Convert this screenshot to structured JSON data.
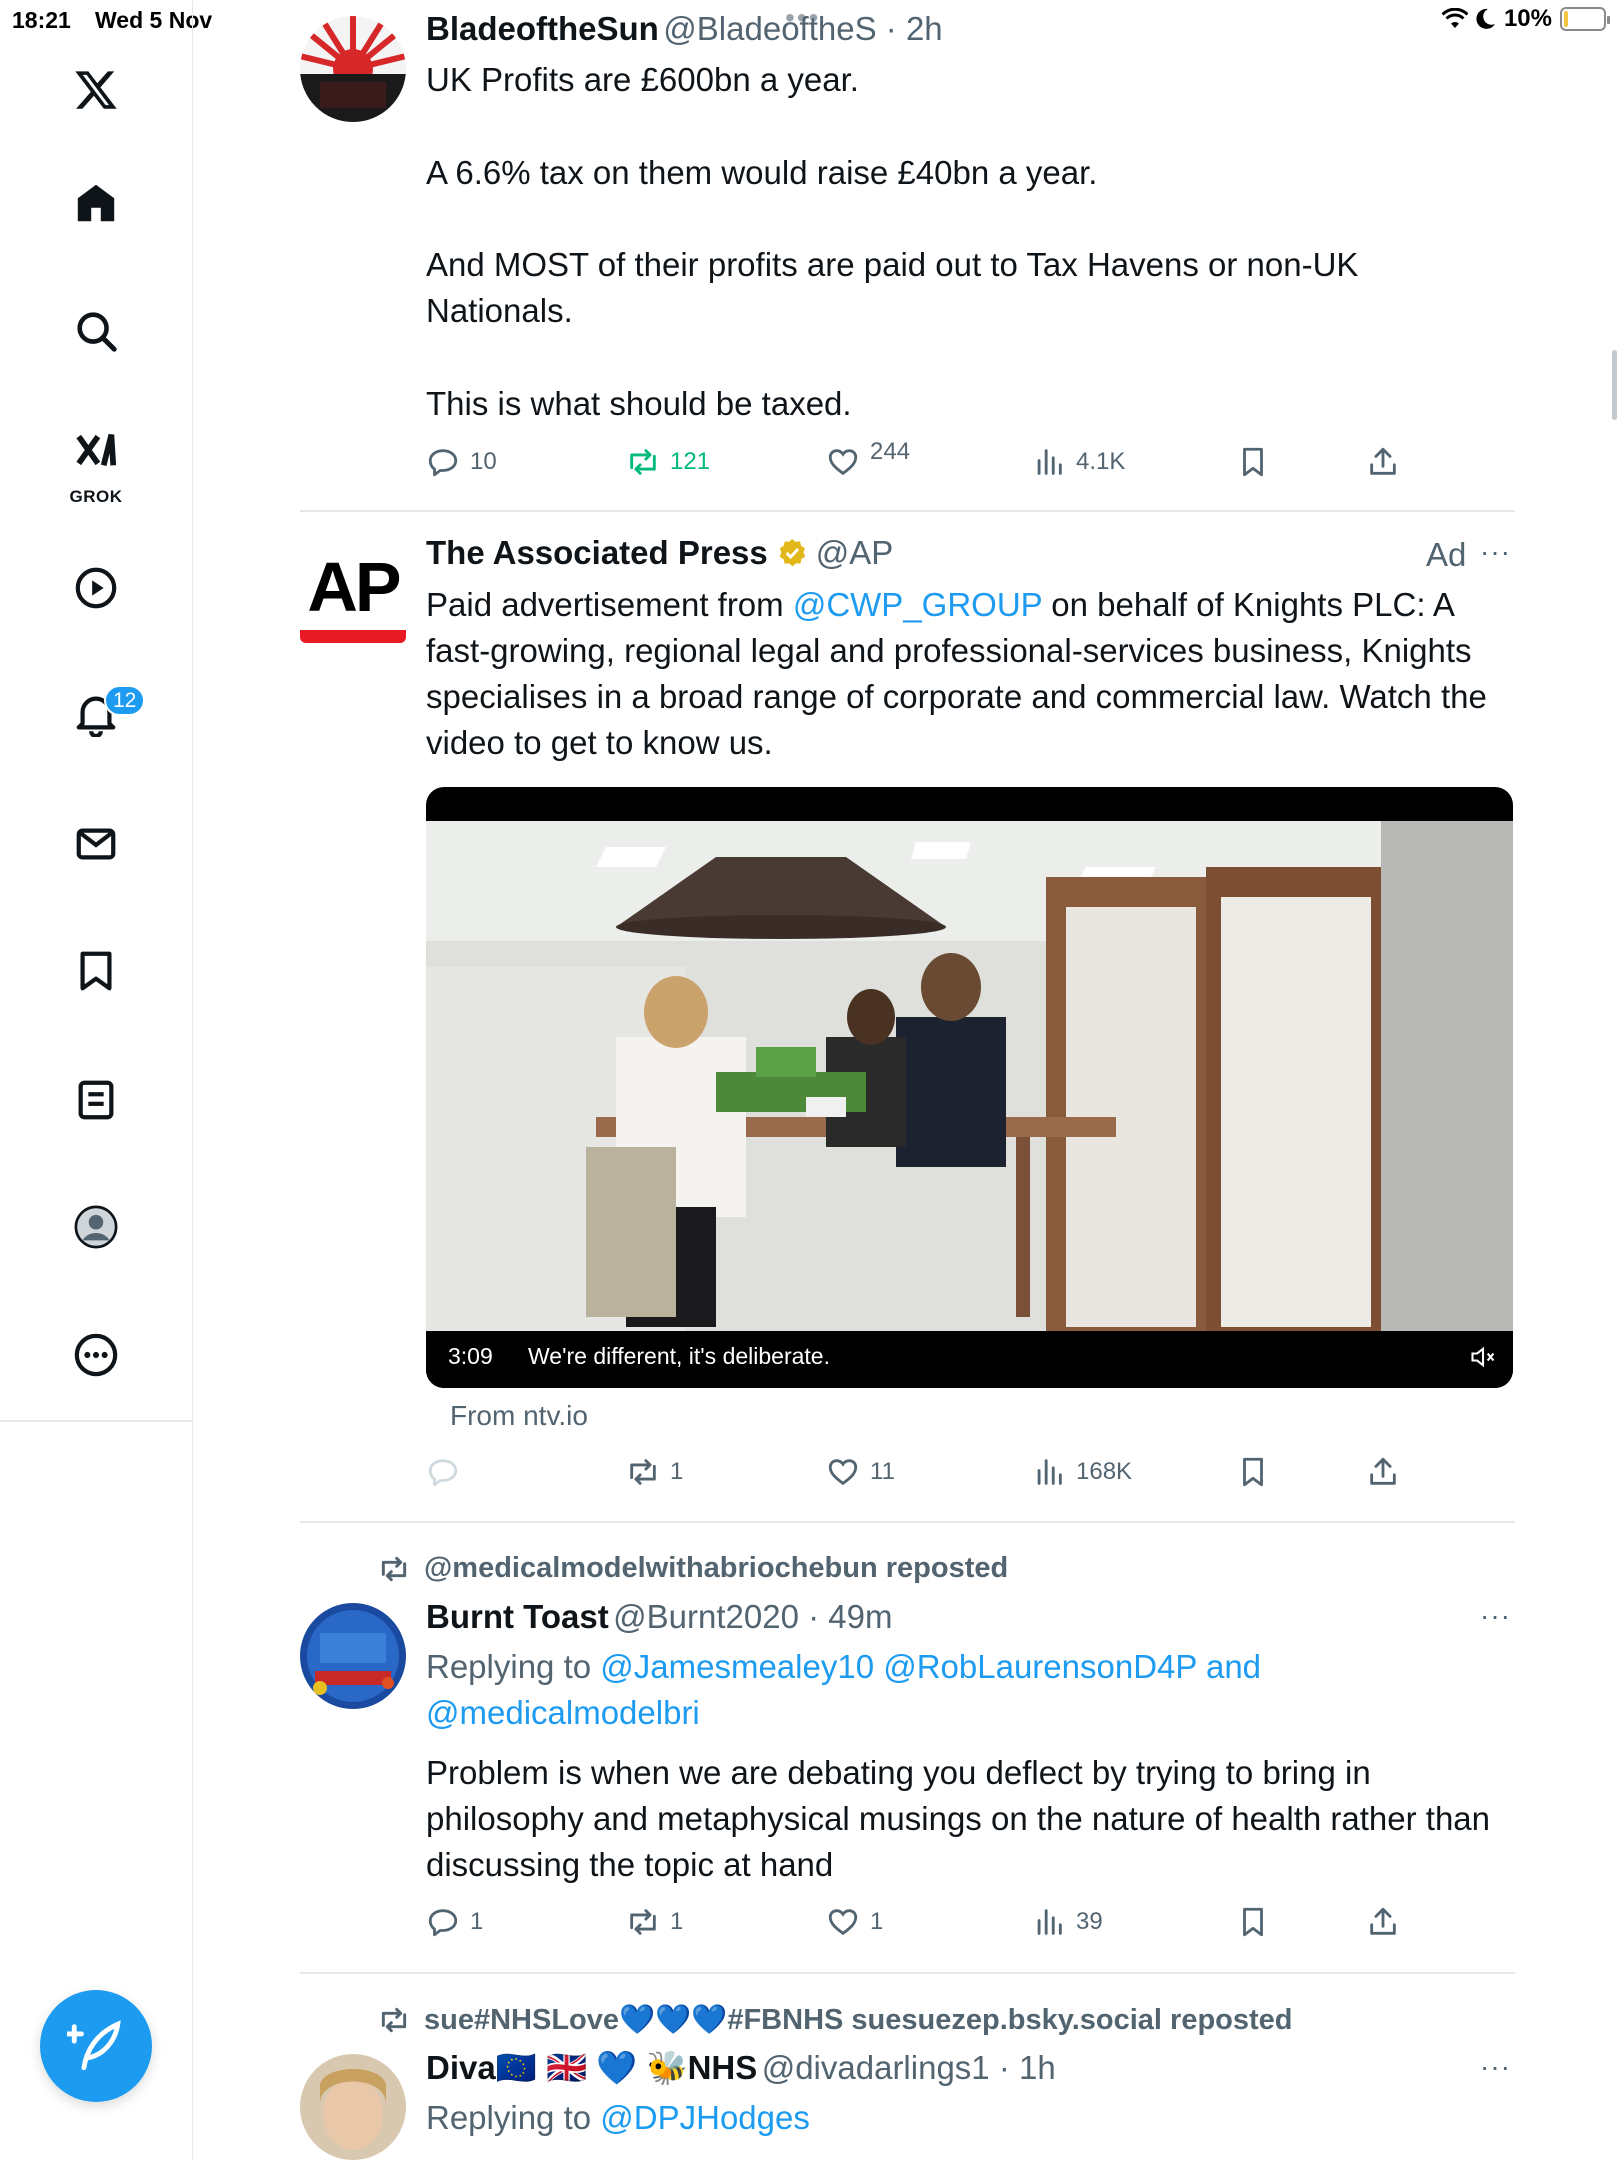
{
  "status_bar": {
    "time": "18:21",
    "date": "Wed 5 Nov",
    "battery": "10%",
    "battery_level": 0.1
  },
  "sidebar": {
    "items": [
      {
        "name": "x-logo-icon"
      },
      {
        "name": "home-icon"
      },
      {
        "name": "search-icon"
      },
      {
        "name": "grok-icon",
        "label": "GROK"
      },
      {
        "name": "video-icon"
      },
      {
        "name": "notifications-icon",
        "badge": "12"
      },
      {
        "name": "messages-icon"
      },
      {
        "name": "bookmarks-icon"
      },
      {
        "name": "lists-icon"
      },
      {
        "name": "profile-icon"
      },
      {
        "name": "more-icon"
      }
    ],
    "compose": "compose-icon"
  },
  "accent": "#1d9bf0",
  "posts": [
    {
      "name": "BladeoftheSun",
      "handle": "@BladeoftheS",
      "time": "2h",
      "text": [
        "UK Profits are £600bn a year.",
        "A 6.6% tax on them would raise £40bn a year.",
        "And MOST of their profits are paid out to Tax Havens or non-UK Nationals.",
        "This is what should be taxed."
      ],
      "replies": "10",
      "reposts": "121",
      "likes": "244",
      "views": "4.1K"
    },
    {
      "name": "The Associated Press",
      "handle": "@AP",
      "ad_label": "Ad",
      "text_before": "Paid advertisement from ",
      "mention": "@CWP_GROUP",
      "text_after": " on behalf of Knights PLC: A fast-growing, regional legal and professional-services business, Knights specialises in a broad range of corporate and commercial law. Watch the video to get to know us.",
      "video_duration": "3:09",
      "video_caption": "We're different, it's deliberate.",
      "source": "From ntv.io",
      "replies": "",
      "reposts": "1",
      "likes": "11",
      "views": "168K"
    },
    {
      "reposted_by": "@medicalmodelwithabriochebun reposted",
      "name": "Burnt Toast",
      "handle": "@Burnt2020",
      "time": "49m",
      "replying_label": "Replying to ",
      "replying_to": "@Jamesmealey10 @RobLaurensonD4P and @medicalmodelbri",
      "text": "Problem is when we are debating you deflect by trying to bring in philosophy and metaphysical musings on the nature of health rather than discussing the topic at hand",
      "replies": "1",
      "reposts": "1",
      "likes": "1",
      "views": "39"
    },
    {
      "reposted_by": "sue#NHSLove💙💙💙#FBNHS suesuezep.bsky.social reposted",
      "name": "Diva🇪🇺 🇬🇧 💙 🐝NHS",
      "handle": "@divadarlings1",
      "time": "1h",
      "replying_label": "Replying to ",
      "replying_to": "@DPJHodges"
    }
  ]
}
